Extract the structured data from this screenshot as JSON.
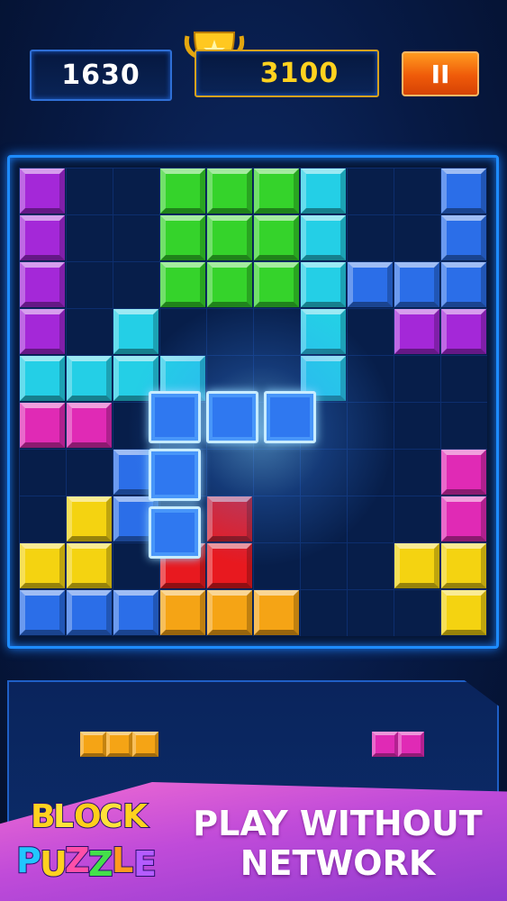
{
  "hud": {
    "score": "1630",
    "best_score": "3100",
    "pause_symbol": "II",
    "trophy_icon": "trophy-icon"
  },
  "board": {
    "rows": 10,
    "cols": 10,
    "cells": [
      {
        "r": 0,
        "c": 0,
        "color": "purple"
      },
      {
        "r": 0,
        "c": 3,
        "color": "green"
      },
      {
        "r": 0,
        "c": 4,
        "color": "green"
      },
      {
        "r": 0,
        "c": 5,
        "color": "green"
      },
      {
        "r": 0,
        "c": 6,
        "color": "cyan"
      },
      {
        "r": 0,
        "c": 9,
        "color": "blue"
      },
      {
        "r": 1,
        "c": 0,
        "color": "purple"
      },
      {
        "r": 1,
        "c": 3,
        "color": "green"
      },
      {
        "r": 1,
        "c": 4,
        "color": "green"
      },
      {
        "r": 1,
        "c": 5,
        "color": "green"
      },
      {
        "r": 1,
        "c": 6,
        "color": "cyan"
      },
      {
        "r": 1,
        "c": 9,
        "color": "blue"
      },
      {
        "r": 2,
        "c": 0,
        "color": "purple"
      },
      {
        "r": 2,
        "c": 3,
        "color": "green"
      },
      {
        "r": 2,
        "c": 4,
        "color": "green"
      },
      {
        "r": 2,
        "c": 5,
        "color": "green"
      },
      {
        "r": 2,
        "c": 6,
        "color": "cyan"
      },
      {
        "r": 2,
        "c": 7,
        "color": "blue"
      },
      {
        "r": 2,
        "c": 8,
        "color": "blue"
      },
      {
        "r": 2,
        "c": 9,
        "color": "blue"
      },
      {
        "r": 3,
        "c": 0,
        "color": "purple"
      },
      {
        "r": 3,
        "c": 2,
        "color": "cyan"
      },
      {
        "r": 3,
        "c": 6,
        "color": "cyan"
      },
      {
        "r": 3,
        "c": 8,
        "color": "purple"
      },
      {
        "r": 3,
        "c": 9,
        "color": "purple"
      },
      {
        "r": 4,
        "c": 0,
        "color": "cyan"
      },
      {
        "r": 4,
        "c": 1,
        "color": "cyan"
      },
      {
        "r": 4,
        "c": 2,
        "color": "cyan"
      },
      {
        "r": 4,
        "c": 3,
        "color": "cyan"
      },
      {
        "r": 4,
        "c": 6,
        "color": "cyan"
      },
      {
        "r": 5,
        "c": 0,
        "color": "magenta"
      },
      {
        "r": 5,
        "c": 1,
        "color": "magenta"
      },
      {
        "r": 6,
        "c": 2,
        "color": "blue"
      },
      {
        "r": 6,
        "c": 9,
        "color": "magenta"
      },
      {
        "r": 7,
        "c": 1,
        "color": "yellow"
      },
      {
        "r": 7,
        "c": 2,
        "color": "blue"
      },
      {
        "r": 7,
        "c": 4,
        "color": "red"
      },
      {
        "r": 7,
        "c": 9,
        "color": "magenta"
      },
      {
        "r": 8,
        "c": 0,
        "color": "yellow"
      },
      {
        "r": 8,
        "c": 1,
        "color": "yellow"
      },
      {
        "r": 8,
        "c": 3,
        "color": "red"
      },
      {
        "r": 8,
        "c": 4,
        "color": "red"
      },
      {
        "r": 8,
        "c": 8,
        "color": "yellow"
      },
      {
        "r": 8,
        "c": 9,
        "color": "yellow"
      },
      {
        "r": 9,
        "c": 0,
        "color": "blue"
      },
      {
        "r": 9,
        "c": 1,
        "color": "blue"
      },
      {
        "r": 9,
        "c": 2,
        "color": "blue"
      },
      {
        "r": 9,
        "c": 3,
        "color": "orange"
      },
      {
        "r": 9,
        "c": 4,
        "color": "orange"
      },
      {
        "r": 9,
        "c": 5,
        "color": "orange"
      },
      {
        "r": 9,
        "c": 9,
        "color": "yellow"
      }
    ]
  },
  "dragging_piece": {
    "color": "blue",
    "shape": "J-shaped: 3 across top, 2 down from left"
  },
  "tray": {
    "pieces": [
      {
        "color": "orange",
        "count": 3
      },
      {
        "color": "magenta",
        "count": 2
      }
    ]
  },
  "colors": {
    "purple": "#a428d8",
    "green": "#35d32b",
    "cyan": "#24cfe6",
    "blue": "#2b6ee8",
    "magenta": "#e02ab5",
    "yellow": "#f4d311",
    "red": "#e8191f",
    "orange": "#f5a415"
  },
  "promo": {
    "logo_line1": "BLOCK",
    "logo_line2": "PUZZLE",
    "tagline_line1": "PLAY WITHOUT",
    "tagline_line2": "NETWORK"
  }
}
